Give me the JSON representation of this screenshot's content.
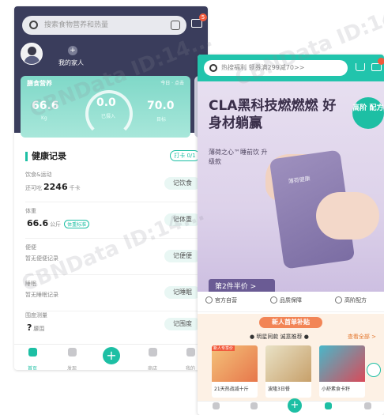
{
  "left_screen": {
    "search_placeholder": "搜索食物营养和热量",
    "message_badge": "5",
    "family_label": "我的家人",
    "add_family": "+",
    "nutrition": {
      "title": "膳食营养",
      "hint": "今日 · 点击",
      "left_value": "66.6",
      "left_label": "Kg",
      "center_value": "0.0",
      "center_label": "已摄入",
      "right_value": "70.0",
      "right_label": "目标"
    },
    "records_title": "健康记录",
    "checkin_label": "打卡 0/1",
    "rows": [
      {
        "label": "饮食&运动",
        "prefix": "还可吃",
        "value": "2246",
        "unit": "千卡",
        "tag": "",
        "button": "记饮食"
      },
      {
        "label": "体重",
        "prefix": "",
        "value": "66.6",
        "unit": "公斤",
        "tag": "体重标准",
        "button": "记体重"
      },
      {
        "label": "便便",
        "prefix": "暂无便便记录",
        "value": "",
        "unit": "",
        "tag": "",
        "button": "记便便"
      },
      {
        "label": "睡眠",
        "prefix": "暂无睡眠记录",
        "value": "",
        "unit": "",
        "tag": "",
        "button": "记睡眠"
      },
      {
        "label": "围度测量",
        "prefix": "",
        "value": "?",
        "unit": "腰围",
        "tag": "",
        "button": "记围度"
      }
    ],
    "tabs": [
      {
        "label": "首页"
      },
      {
        "label": "发现"
      },
      {
        "label": "商店"
      },
      {
        "label": "我的"
      }
    ]
  },
  "right_screen": {
    "search_placeholder": "热搜福利 领券满299减70>>",
    "banner": {
      "headline": "CLA黑科技燃燃燃 好身材躺赢",
      "sub": "薄荷之心™睡前饮 升级款",
      "badge": "高阶 配方",
      "promo": "第2件半价 >",
      "pouch_label": "薄荷健康"
    },
    "features": [
      "官方自营",
      "品质保障",
      "高阶配方"
    ],
    "new_user": {
      "title": "新人首单补贴",
      "hot": "● 明星同款 诚意推荐 ●",
      "view_all": "查看全部 >",
      "cards": [
        {
          "name": "21天热战减十斤",
          "tag": "新人专享价"
        },
        {
          "name": "波隆3日餐",
          "tag": ""
        },
        {
          "name": "小舒素食卡籽",
          "tag": ""
        }
      ]
    },
    "tabs": [
      {
        "label": "首页"
      },
      {
        "label": "发现"
      },
      {
        "label": "商店"
      },
      {
        "label": "我的"
      }
    ]
  },
  "watermark": "CBNData ID:14...",
  "colors": {
    "accent": "#1dbfa4",
    "header_dark": "#3a3d5c",
    "promo_purple": "#6a5b94",
    "orange": "#f28556"
  }
}
